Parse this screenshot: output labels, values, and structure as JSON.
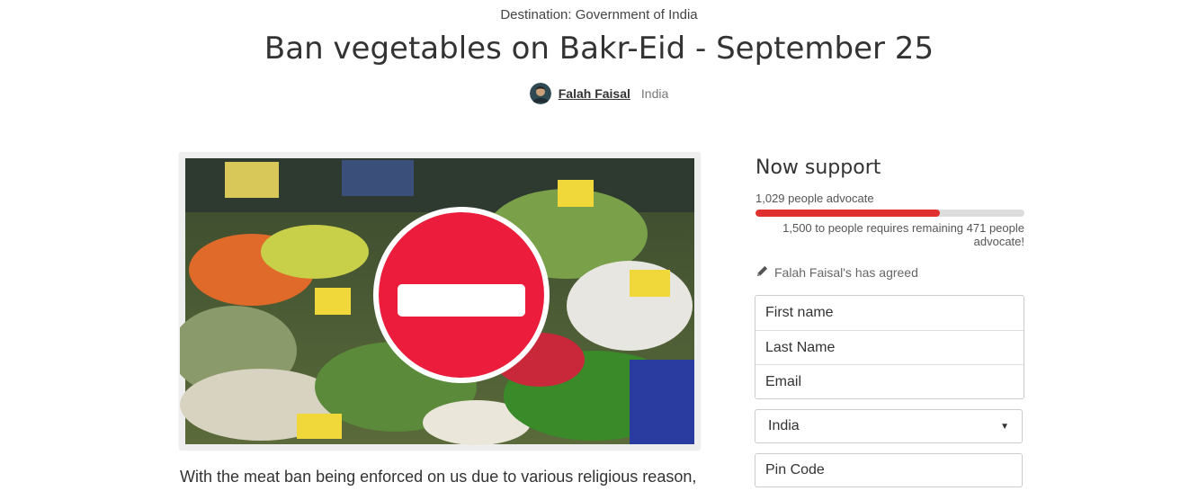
{
  "destination": "Destination: Government of India",
  "petition_title": "Ban vegetables on Bakr-Eid - September 25",
  "author": {
    "name": "Falah Faisal",
    "location": "India"
  },
  "hero_image": {
    "icon": "no-entry-sign-icon"
  },
  "body_text": "With the meat ban being enforced on us due to various religious reason,",
  "support": {
    "title": "Now support",
    "advocate_count": "1,029 people advocate",
    "progress": 0.686,
    "remaining": "1,500 to people requires remaining 471 people advocate!",
    "agreed": "Falah Faisal's has agreed",
    "agreed_icon": "pencil-icon"
  },
  "form": {
    "first_name_placeholder": "First name",
    "last_name_placeholder": "Last Name",
    "email_placeholder": "Email",
    "country_selected": "India",
    "pincode_placeholder": "Pin Code"
  },
  "colors": {
    "progress_fill": "#e03030",
    "progress_track": "#dddddd",
    "sign_red": "#ec1c3c"
  }
}
